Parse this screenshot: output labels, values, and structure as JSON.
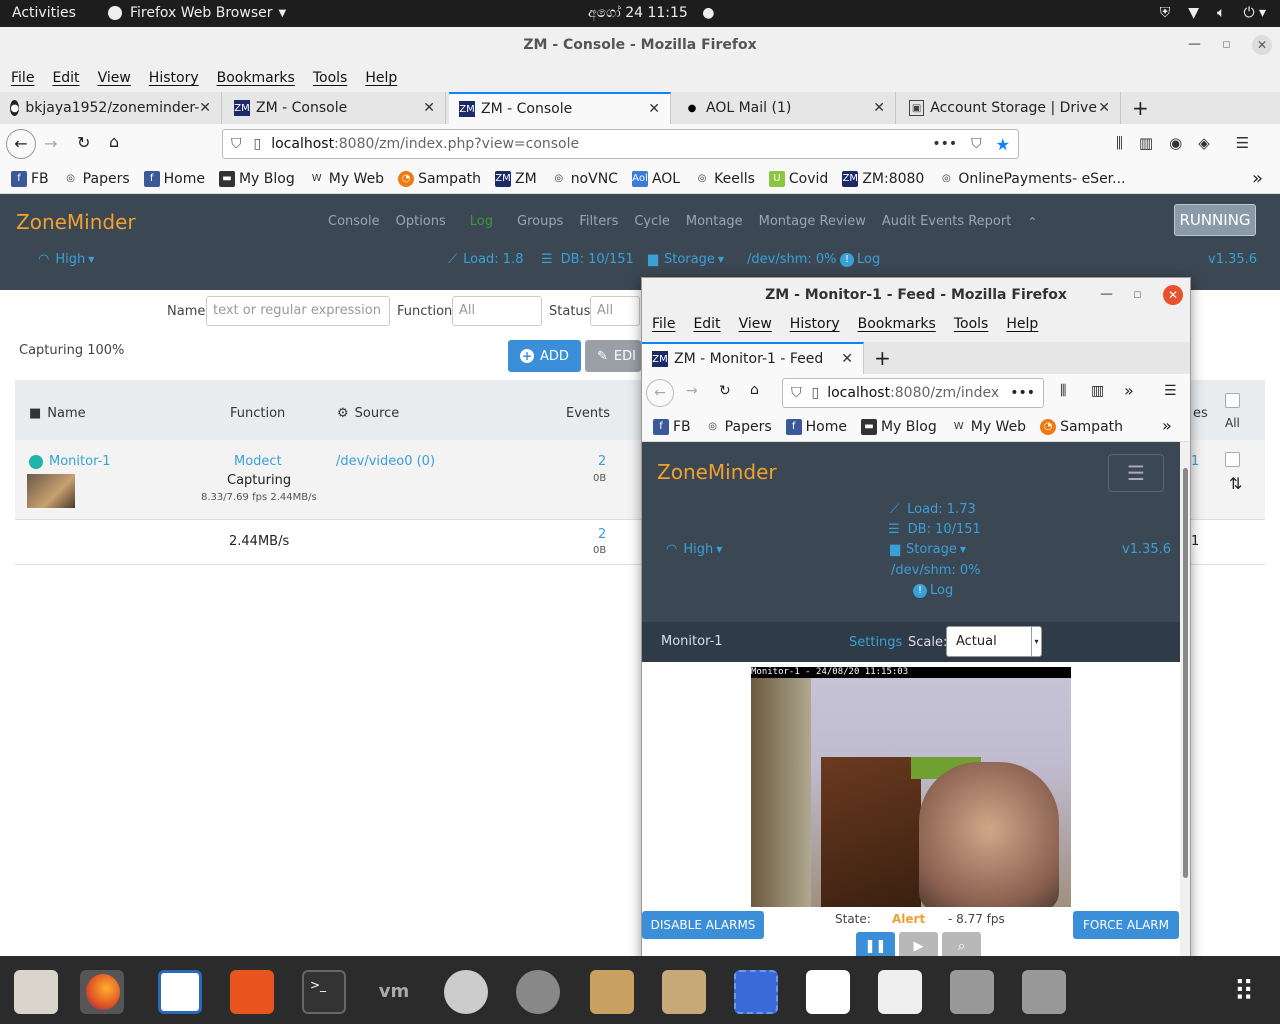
{
  "topbar": {
    "activities": "Activities",
    "app": "Firefox Web Browser",
    "clock": "අගෝ 24  11:15"
  },
  "window": {
    "title": "ZM - Console - Mozilla Firefox"
  },
  "menu": [
    "File",
    "Edit",
    "View",
    "History",
    "Bookmarks",
    "Tools",
    "Help"
  ],
  "tabs": [
    {
      "label": "bkjaya1952/zoneminder-",
      "active": false
    },
    {
      "label": "ZM - Console",
      "active": false
    },
    {
      "label": "ZM - Console",
      "active": true
    },
    {
      "label": "AOL Mail (1)",
      "active": false
    },
    {
      "label": "Account Storage | DriveH",
      "active": false
    }
  ],
  "url": {
    "host": "localhost",
    "rest": ":8080/zm/index.php?view=console"
  },
  "bookmarks": [
    "FB",
    "Papers",
    "Home",
    "My Blog",
    "My Web",
    "Sampath",
    "ZM",
    "noVNC",
    "AOL",
    "Keells",
    "Covid",
    "ZM:8080",
    "OnlinePayments- eSer..."
  ],
  "zm": {
    "brand": "ZoneMinder",
    "nav": [
      "Console",
      "Options",
      "Log",
      "Groups",
      "Filters",
      "Cycle",
      "Montage",
      "Montage Review",
      "Audit Events Report"
    ],
    "running": "RUNNING",
    "bandwidth": "High",
    "load": "Load: 1.8",
    "db": "DB: 10/151",
    "storage": "Storage",
    "shm": "/dev/shm: 0%",
    "log": "Log",
    "version": "v1.35.6"
  },
  "filters": {
    "name_label": "Name",
    "name_placeholder": "text or regular expression",
    "function_label": "Function",
    "function_value": "All",
    "status_label": "Status",
    "status_value": "All"
  },
  "capturing": "Capturing 100%",
  "buttons": {
    "add": "ADD",
    "edit": "EDI"
  },
  "table": {
    "headers": {
      "name": "Name",
      "function": "Function",
      "source": "Source",
      "events": "Events",
      "es": "es",
      "all": "All"
    },
    "row": {
      "name": "Monitor-1",
      "function": "Modect",
      "status": "Capturing",
      "fps": "8.33/7.69 fps 2.44MB/s",
      "source": "/dev/video0 (0)",
      "events": "2",
      "events_size": "0B",
      "right_val": "1"
    },
    "footer": {
      "bandwidth": "2.44MB/s",
      "events": "2",
      "events_size": "0B",
      "right_val": "1"
    }
  },
  "popup": {
    "title": "ZM - Monitor-1 - Feed - Mozilla Firefox",
    "menu": [
      "File",
      "Edit",
      "View",
      "History",
      "Bookmarks",
      "Tools",
      "Help"
    ],
    "tab": "ZM - Monitor-1 - Feed",
    "url_host": "localhost",
    "url_rest": ":8080/zm/index",
    "bookmarks": [
      "FB",
      "Papers",
      "Home",
      "My Blog",
      "My Web",
      "Sampath"
    ],
    "brand": "ZoneMinder",
    "load": "Load: 1.73",
    "db": "DB: 10/151",
    "storage": "Storage",
    "shm": "/dev/shm: 0%",
    "log": "Log",
    "bandwidth": "High",
    "version": "v1.35.6",
    "monitor": "Monitor-1",
    "settings": "Settings",
    "scale_label": "Scale:",
    "scale_value": "Actual",
    "overlay": "Monitor-1 - 24/08/20 11:15:03",
    "state_label": "State:",
    "state_value": "Alert",
    "fps": "- 8.77 fps",
    "disable_alarms": "DISABLE ALARMS",
    "force_alarm": "FORCE ALARM"
  },
  "colors": {
    "accent": "#3aa0d8",
    "brand": "#f0a030",
    "header": "#3b4752",
    "alert": "#f0a030"
  }
}
